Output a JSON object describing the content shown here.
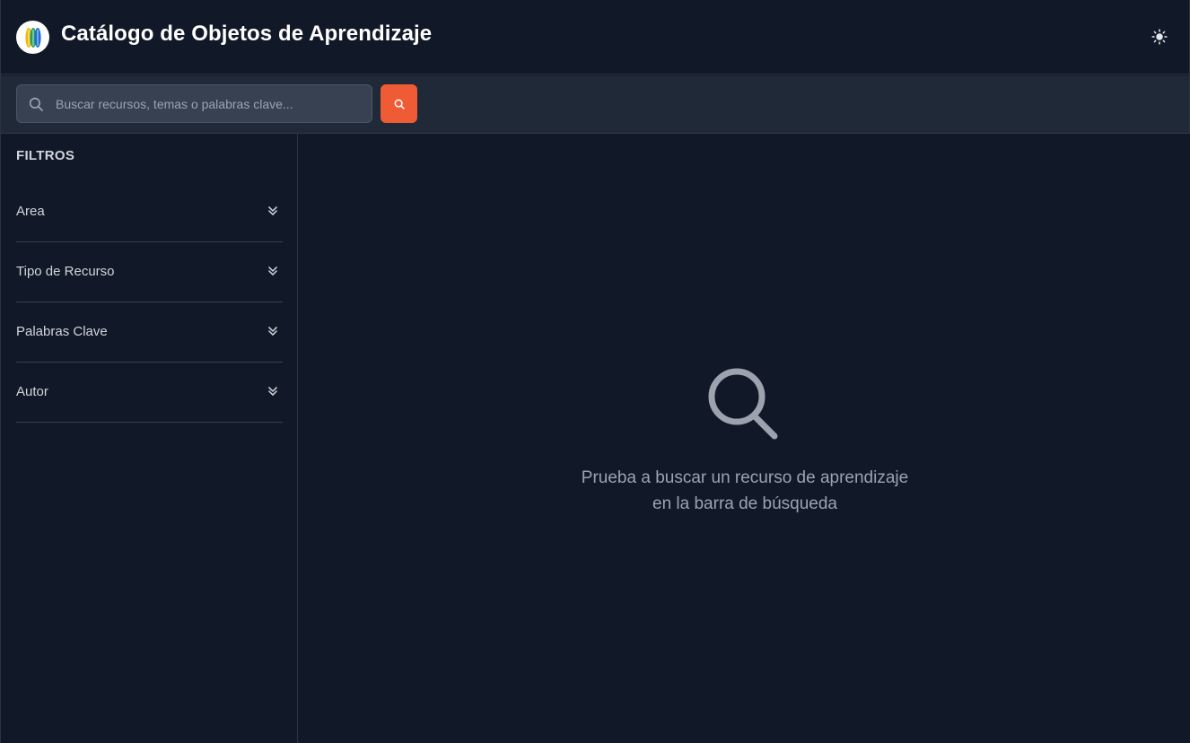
{
  "header": {
    "app_title": "Catálogo de Objetos de Aprendizaje",
    "logo_icon": "leaves-logo-icon",
    "theme_toggle_icon": "sun-icon"
  },
  "search": {
    "placeholder": "Buscar recursos, temas o palabras clave...",
    "value": "",
    "input_icon": "search-icon",
    "button_icon": "search-icon"
  },
  "sidebar": {
    "title": "FILTROS",
    "filters": [
      {
        "label": "Area",
        "icon": "chevrons-down-icon"
      },
      {
        "label": "Tipo de Recurso",
        "icon": "chevrons-down-icon"
      },
      {
        "label": "Palabras Clave",
        "icon": "chevrons-down-icon"
      },
      {
        "label": "Autor",
        "icon": "chevrons-down-icon"
      }
    ]
  },
  "main": {
    "empty_state": {
      "icon": "magnifier-icon",
      "line1": "Prueba a buscar un recurso de aprendizaje",
      "line2": "en la barra de búsqueda"
    }
  },
  "colors": {
    "background": "#111827",
    "search_bar": "#1f2937",
    "accent": "#ef5b35",
    "logo_green": "#22a05a",
    "logo_yellow": "#f2b705",
    "logo_blue": "#1f6fd1"
  }
}
